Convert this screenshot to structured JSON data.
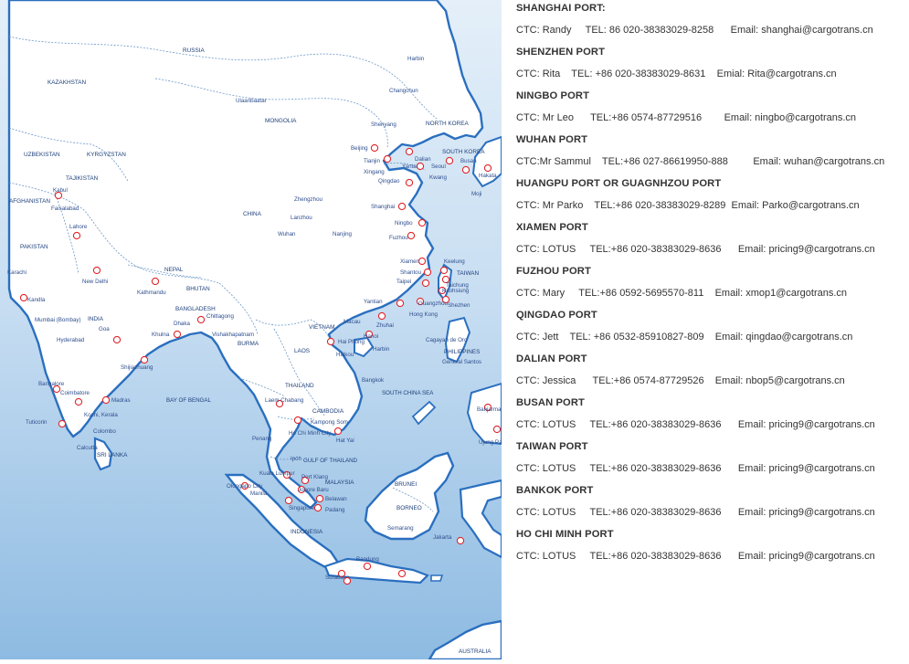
{
  "map": {
    "countries": [
      "RUSSIA",
      "KAZAKHSTAN",
      "MONGOLIA",
      "UZBEKISTAN",
      "KYRGYZSTAN",
      "TAJIKISTAN",
      "AFGHANISTAN",
      "PAKISTAN",
      "CHINA",
      "NEPAL",
      "BHUTAN",
      "BANGLADESH",
      "INDIA",
      "BURMA",
      "LAOS",
      "THAILAND",
      "VIETNAM",
      "CAMBODIA",
      "MALAYSIA",
      "INDONESIA",
      "BRUNEI",
      "BORNEO",
      "PHILIPPINES",
      "NORTH KOREA",
      "SOUTH KOREA",
      "TAIWAN",
      "SRI LANKA",
      "AUSTRALIA"
    ],
    "seas": [
      "BAY OF BENGAL",
      "SOUTH CHINA SEA",
      "GULF OF THAILAND"
    ],
    "cities": [
      "Harbin",
      "Changchun",
      "Ulaanbaatar",
      "Shenyang",
      "Beijing",
      "Dalian",
      "Tianjin",
      "Yantai",
      "Xingang",
      "Qingdao",
      "Seoul",
      "Busan",
      "Kwang",
      "Hakata",
      "Moji",
      "Kabul",
      "Faisalabad",
      "Lahore",
      "Karachi",
      "New Delhi",
      "Kathmandu",
      "Kandla",
      "Mumbai (Bombay)",
      "Hyderabad",
      "Goa",
      "Bangalore",
      "Madras",
      "Coimbatore",
      "Kochi, Kerala",
      "Tuticorin",
      "Colombo",
      "Calcutta",
      "Khulna",
      "Dhaka",
      "Chittagong",
      "Vishakhapatnam",
      "Shijiazhuang",
      "Zhengzhou",
      "Lanzhou",
      "Wuhan",
      "Nanjing",
      "Shanghai",
      "Ningbo",
      "Fuzhou",
      "Xiamen",
      "Shantou",
      "Taipei",
      "Keelung",
      "Taichung",
      "Kaohsiung",
      "Shezhen",
      "Guangzhou",
      "Yantian",
      "Hong Kong",
      "Zhuhai",
      "Macau",
      "Hanoi",
      "Hai Phong",
      "Haikou",
      "Harbin",
      "Bangkok",
      "Laem Chabang",
      "Kampong Som",
      "Ho Chi Minh City",
      "Hat Yai",
      "Penang",
      "Ipoh",
      "Kuala Lumpur",
      "Port Klang",
      "Johore Baru",
      "Singapore",
      "Belawan",
      "Padang",
      "Olongapo City",
      "Manila",
      "Cagayan de Oro",
      "General Santos",
      "Banjarmasin",
      "Ujung Padang",
      "Semarang",
      "Jakarta",
      "Bandung",
      "Surabaya"
    ]
  },
  "ports": [
    {
      "title": "SHANGHAI PORT:",
      "line": "CTC: Randy     TEL: 86 020-38383029-8258      Email: shanghai@cargotrans.cn"
    },
    {
      "title": "SHENZHEN PORT",
      "line": "CTC: Rita    TEL: +86 020-38383029-8631    Emial: Rita@cargotrans.cn"
    },
    {
      "title": "NINGBO PORT",
      "line": "CTC: Mr Leo      TEL:+86 0574-87729516        Email: ningbo@cargotrans.cn"
    },
    {
      "title": "WUHAN PORT",
      "line": "CTC:Mr Sammul    TEL:+86 027-86619950-888         Email: wuhan@cargotrans.cn"
    },
    {
      "title": "HUANGPU PORT OR GUAGNHZOU PORT",
      "line": "CTC: Mr Parko    TEL:+86 020-38383029-8289  Email: Parko@cargotrans.cn"
    },
    {
      "title": "XIAMEN PORT",
      "line": "CTC: LOTUS     TEL:+86 020-38383029-8636      Email: pricing9@cargotrans.cn"
    },
    {
      "title": "FUZHOU PORT",
      "line": "CTC: Mary     TEL:+86 0592-5695570-811    Email: xmop1@cargotrans.cn"
    },
    {
      "title": "QINGDAO PORT",
      "line": "CTC: Jett    TEL: +86 0532-85910827-809    Email: qingdao@cargotrans.cn"
    },
    {
      "title": "DALIAN PORT",
      "line": "CTC: Jessica      TEL:+86 0574-87729526    Email: nbop5@cargotrans.cn"
    },
    {
      "title": "BUSAN PORT",
      "line": "CTC: LOTUS     TEL:+86 020-38383029-8636      Email: pricing9@cargotrans.cn"
    },
    {
      "title": "TAIWAN  PORT",
      "line": "CTC: LOTUS     TEL:+86 020-38383029-8636      Email: pricing9@cargotrans.cn"
    },
    {
      "title": "BANKOK PORT",
      "line": "CTC: LOTUS     TEL:+86 020-38383029-8636      Email: pricing9@cargotrans.cn"
    },
    {
      "title": "HO CHI MINH PORT",
      "line": "CTC: LOTUS     TEL:+86 020-38383029-8636      Email: pricing9@cargotrans.cn"
    }
  ],
  "colors": {
    "land": "#ffffff",
    "sea_top": "#dbe9f6",
    "sea_bottom": "#8fbce3",
    "coast": "#2a6fbf",
    "text": "#333333",
    "dot": "#e0262b"
  }
}
